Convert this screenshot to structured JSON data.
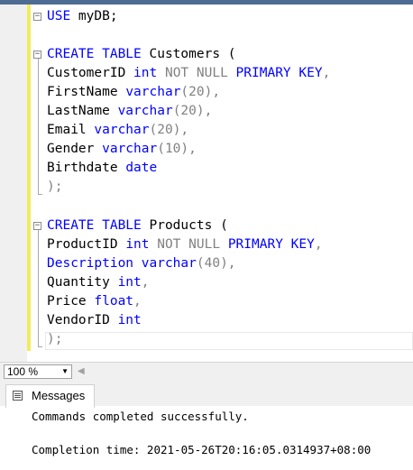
{
  "editor": {
    "use_kw": "USE",
    "use_db": " myDB;",
    "create1_kw": "CREATE TABLE",
    "create1_name": " Customers (",
    "c1_name": "CustomerID ",
    "c1_type": "int",
    "c1_gray": " NOT NULL ",
    "c1_pk": "PRIMARY KEY",
    "c1_comma": ",",
    "c2_name": "FirstName ",
    "c2_type": "varchar",
    "c2_size": "(20),",
    "c3_name": "LastName ",
    "c3_type": "varchar",
    "c3_size": "(20),",
    "c4_name": "Email ",
    "c4_type": "varchar",
    "c4_size": "(20),",
    "c5_name": "Gender ",
    "c5_type": "varchar",
    "c5_size": "(10),",
    "c6_name": "Birthdate ",
    "c6_type": "date",
    "close1": ");",
    "create2_kw": "CREATE TABLE",
    "create2_name": " Products (",
    "p1_name": "ProductID ",
    "p1_type": "int",
    "p1_gray": " NOT NULL ",
    "p1_pk": "PRIMARY KEY",
    "p1_comma": ",",
    "p2_name": "Description",
    "p2_sp": " ",
    "p2_type": "varchar",
    "p2_size": "(40),",
    "p3_name": "Quantity ",
    "p3_type": "int",
    "p3_comma": ",",
    "p4_name": "Price ",
    "p4_type": "float",
    "p4_comma": ",",
    "p5_name": "VendorID ",
    "p5_type": "int",
    "close2": ");"
  },
  "status": {
    "zoom": "100 %"
  },
  "messages": {
    "tab_label": "Messages",
    "line1": "Commands completed successfully.",
    "line2": "Completion time: 2021-05-26T20:16:05.0314937+08:00"
  }
}
